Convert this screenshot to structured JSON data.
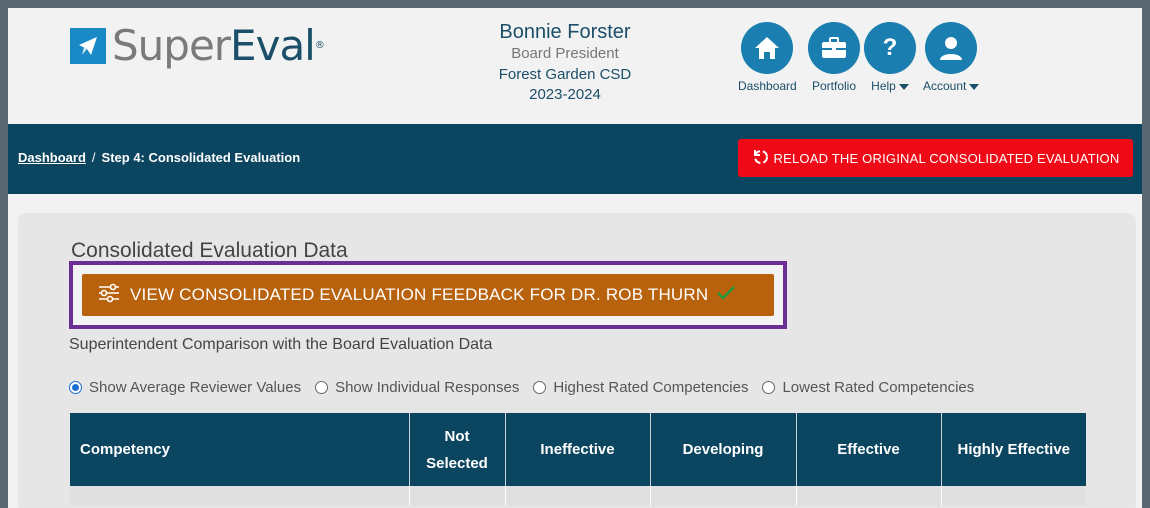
{
  "brand": {
    "logo_super": "Super",
    "logo_eval": "Eval",
    "trademark": "®"
  },
  "user": {
    "name": "Bonnie Forster",
    "role": "Board President",
    "organization": "Forest Garden CSD",
    "year": "2023-2024"
  },
  "nav": {
    "dashboard": "Dashboard",
    "portfolio": "Portfolio",
    "help": "Help",
    "account": "Account"
  },
  "breadcrumb": {
    "home": "Dashboard",
    "separator": "/",
    "current": "Step 4: Consolidated Evaluation"
  },
  "reload_button": "RELOAD THE ORIGINAL CONSOLIDATED EVALUATION",
  "panel": {
    "title": "Consolidated Evaluation Data",
    "feedback_button": "VIEW CONSOLIDATED EVALUATION FEEDBACK FOR DR. ROB THURN",
    "subtitle": "Superintendent Comparison with the Board Evaluation Data",
    "radio_options": [
      {
        "label": "Show Average Reviewer Values",
        "selected": true
      },
      {
        "label": "Show Individual Responses",
        "selected": false
      },
      {
        "label": "Highest Rated Competencies",
        "selected": false
      },
      {
        "label": "Lowest Rated Competencies",
        "selected": false
      }
    ]
  },
  "table": {
    "headers": [
      "Competency",
      "Not Selected",
      "Ineffective",
      "Developing",
      "Effective",
      "Highly Effective"
    ]
  },
  "colors": {
    "brand_blue": "#1a7eb0",
    "navy": "#0b4560",
    "reload_red": "#ee0a16",
    "feedback_orange": "#b8620e",
    "highlight_purple": "#6b2e93"
  }
}
